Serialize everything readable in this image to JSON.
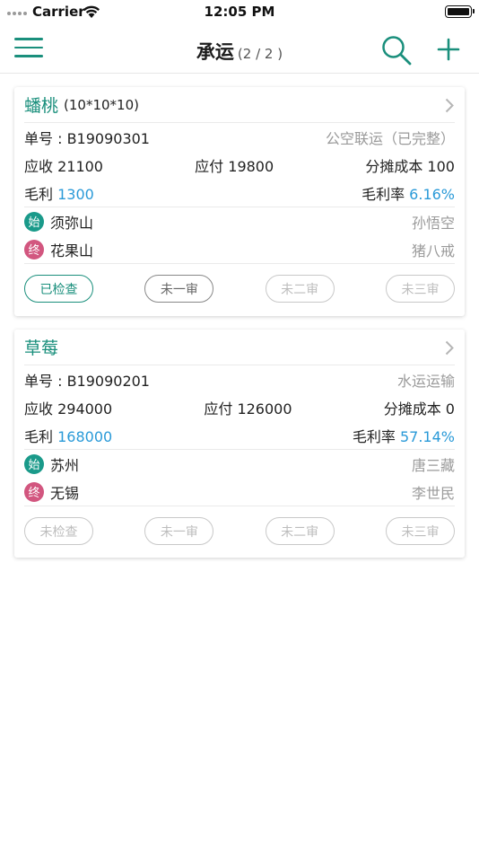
{
  "status_bar": {
    "carrier": "Carrier",
    "time": "12:05 PM"
  },
  "nav": {
    "title": "承运",
    "count": "(2 / 2 )"
  },
  "colors": {
    "accent": "#1a8f7c",
    "blue_value": "#2a9ad8",
    "start_badge": "#1a9a8a",
    "end_badge": "#d2567f"
  },
  "icons": {
    "menu": "hamburger-icon",
    "search": "search-icon",
    "add": "plus-icon",
    "chevron": "chevron-right-icon",
    "wifi": "wifi-icon",
    "battery": "battery-icon"
  },
  "cards": [
    {
      "name": "蟠桃",
      "spec": "(10*10*10)",
      "order_no": "单号 : B19090301",
      "transport": "公空联运（已完整）",
      "receivable": "应收 21100",
      "payable": "应付 19800",
      "allocated_cost": "分摊成本 100",
      "gross_profit_label": "毛利",
      "gross_profit_value": "1300",
      "gross_margin_label": "毛利率",
      "gross_margin_value": "6.16%",
      "start_badge": "始",
      "start_place": "须弥山",
      "start_person": "孙悟空",
      "end_badge": "终",
      "end_place": "花果山",
      "end_person": "猪八戒",
      "buttons": [
        "已检查",
        "未一审",
        "未二审",
        "未三审"
      ]
    },
    {
      "name": "草莓",
      "spec": "",
      "order_no": "单号 : B19090201",
      "transport": "水运运输",
      "receivable": "应收 294000",
      "payable": "应付 126000",
      "allocated_cost": "分摊成本 0",
      "gross_profit_label": "毛利",
      "gross_profit_value": "168000",
      "gross_margin_label": "毛利率",
      "gross_margin_value": "57.14%",
      "start_badge": "始",
      "start_place": "苏州",
      "start_person": "唐三藏",
      "end_badge": "终",
      "end_place": "无锡",
      "end_person": "李世民",
      "buttons": [
        "未检查",
        "未一审",
        "未二审",
        "未三审"
      ]
    }
  ]
}
